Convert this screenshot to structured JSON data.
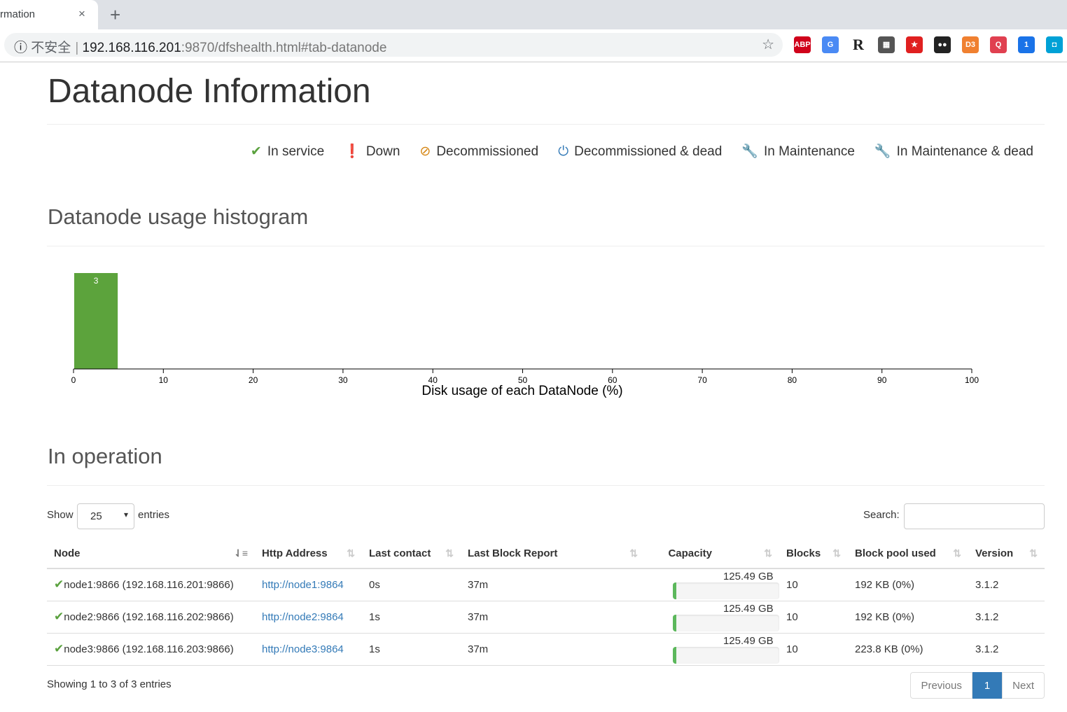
{
  "browser": {
    "tab_title": "rmation",
    "close": "×",
    "new_tab": "+",
    "insecure": "不安全",
    "url_host": "192.168.116.201",
    "url_path": ":9870/dfshealth.html#tab-datanode",
    "star": "☆",
    "extensions": [
      {
        "name": "adblock-plus",
        "label": "ABP",
        "color": "#d0021b"
      },
      {
        "name": "google-translate",
        "label": "G",
        "color": "#4a8af4"
      },
      {
        "name": "r-extension",
        "label": "R",
        "color": "#fff"
      },
      {
        "name": "qr-code",
        "label": "▦",
        "color": "#555"
      },
      {
        "name": "red-star",
        "label": "★",
        "color": "#e02020"
      },
      {
        "name": "tampermonkey",
        "label": "●●",
        "color": "#222"
      },
      {
        "name": "d3",
        "label": "D3",
        "color": "#f08030"
      },
      {
        "name": "search",
        "label": "Q",
        "color": "#e04050"
      },
      {
        "name": "cat",
        "label": "1",
        "color": "#1a73e8"
      },
      {
        "name": "bilibili",
        "label": "◘",
        "color": "#00a1d6"
      }
    ]
  },
  "page": {
    "title": "Datanode Information"
  },
  "legend": [
    {
      "label": "In service",
      "icon": "check-icon",
      "glyph": "✔",
      "color": "#5aa13e"
    },
    {
      "label": "Down",
      "icon": "exclamation-circle-icon",
      "glyph": "❗",
      "color": "#c9302c"
    },
    {
      "label": "Decommissioned",
      "icon": "ban-icon",
      "glyph": "⊘",
      "color": "#d58512"
    },
    {
      "label": "Decommissioned & dead",
      "icon": "power-icon",
      "glyph": "⏻",
      "color": "#337ab7"
    },
    {
      "label": "In Maintenance",
      "icon": "wrench-icon",
      "glyph": "🔧",
      "color": "#f0ad4e"
    },
    {
      "label": "In Maintenance & dead",
      "icon": "wrench-icon",
      "glyph": "🔧",
      "color": "#c7254e"
    }
  ],
  "histogram": {
    "heading": "Datanode usage histogram"
  },
  "chart_data": {
    "type": "bar",
    "xlabel": "Disk usage of each DataNode (%)",
    "xlim": [
      0,
      100
    ],
    "xticks": [
      "0",
      "10",
      "20",
      "30",
      "40",
      "50",
      "60",
      "70",
      "80",
      "90",
      "100"
    ],
    "bins": [
      {
        "x0": 0,
        "x1": 5,
        "count": 3
      }
    ],
    "color": "#5ca33c"
  },
  "operation": {
    "heading": "In operation",
    "show": "Show",
    "entries": "entries",
    "page_size": "25",
    "search_label": "Search:",
    "search_value": "",
    "columns": [
      "Node",
      "Http Address",
      "Last contact",
      "Last Block Report",
      "Capacity",
      "Blocks",
      "Block pool used",
      "Version"
    ],
    "rows": [
      {
        "node": "node1:9866 (192.168.116.201:9866)",
        "http": "http://node1:9864",
        "contact": "0s",
        "report": "37m",
        "capacity": "125.49 GB",
        "used_pct": 3,
        "blocks": "10",
        "pool": "192 KB (0%)",
        "version": "3.1.2"
      },
      {
        "node": "node2:9866 (192.168.116.202:9866)",
        "http": "http://node2:9864",
        "contact": "1s",
        "report": "37m",
        "capacity": "125.49 GB",
        "used_pct": 3,
        "blocks": "10",
        "pool": "192 KB (0%)",
        "version": "3.1.2"
      },
      {
        "node": "node3:9866 (192.168.116.203:9866)",
        "http": "http://node3:9864",
        "contact": "1s",
        "report": "37m",
        "capacity": "125.49 GB",
        "used_pct": 3,
        "blocks": "10",
        "pool": "223.8 KB (0%)",
        "version": "3.1.2"
      }
    ],
    "info": "Showing 1 to 3 of 3 entries",
    "prev": "Previous",
    "page": "1",
    "next": "Next"
  }
}
